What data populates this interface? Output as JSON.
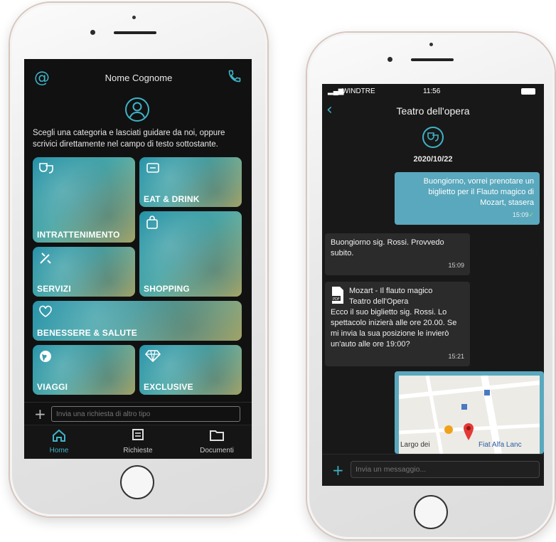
{
  "phone1": {
    "header": {
      "at_icon": "at-sign-icon",
      "name": "Nome Cognome",
      "phone_icon": "phone-icon"
    },
    "avatar_icon": "user-circle-icon",
    "intro_text": "Scegli una categoria e lasciati guidare da noi, oppure scrivici direttamente nel campo di testo sottostante.",
    "categories": [
      {
        "label": "INTRATTENIMENTO",
        "icon": "theater-masks-icon"
      },
      {
        "label": "EAT & DRINK",
        "icon": "menu-card-icon"
      },
      {
        "label": "SHOPPING",
        "icon": "shopping-bag-icon"
      },
      {
        "label": "SERVIZI",
        "icon": "tools-icon"
      },
      {
        "label": "BENESSERE & SALUTE",
        "icon": "heart-icon"
      },
      {
        "label": "VIAGGI",
        "icon": "globe-icon"
      },
      {
        "label": "EXCLUSIVE",
        "icon": "diamond-icon"
      }
    ],
    "request_placeholder": "Invia una richiesta di altro tipo",
    "tabs": [
      {
        "label": "Home",
        "icon": "home-icon"
      },
      {
        "label": "Richieste",
        "icon": "list-icon"
      },
      {
        "label": "Documenti",
        "icon": "folder-icon"
      }
    ],
    "accent": "#3fb3c8"
  },
  "phone2": {
    "status": {
      "carrier": "WINDTRE",
      "time": "11:56"
    },
    "title": "Teatro dell'opera",
    "channel_icon": "theater-masks-icon",
    "date": "2020/10/22",
    "messages": [
      {
        "direction": "out",
        "text": "Buongiorno, vorrei prenotare un biglietto per il Flauto magico di Mozart, stasera",
        "time": "15:09"
      },
      {
        "direction": "in",
        "text": "Buongiorno sig. Rossi. Provvedo subito.",
        "time": "15:09"
      },
      {
        "direction": "in",
        "attachment_title": "Mozart - Il flauto magico",
        "attachment_subtitle": "Teatro dell'Opera",
        "text": "Ecco il suo biglietto sig. Rossi. Lo spettacolo inizierà alle ore 20.00. Se mi invia la sua posizione le invierò un'auto alle ore 19:00?",
        "time": "15:21"
      }
    ],
    "map": {
      "label_left": "Largo dei",
      "label_right": "Fiat Alfa Lanc"
    },
    "message_placeholder": "Invia un messaggio...",
    "bubble_color": "#5aa8bd"
  }
}
